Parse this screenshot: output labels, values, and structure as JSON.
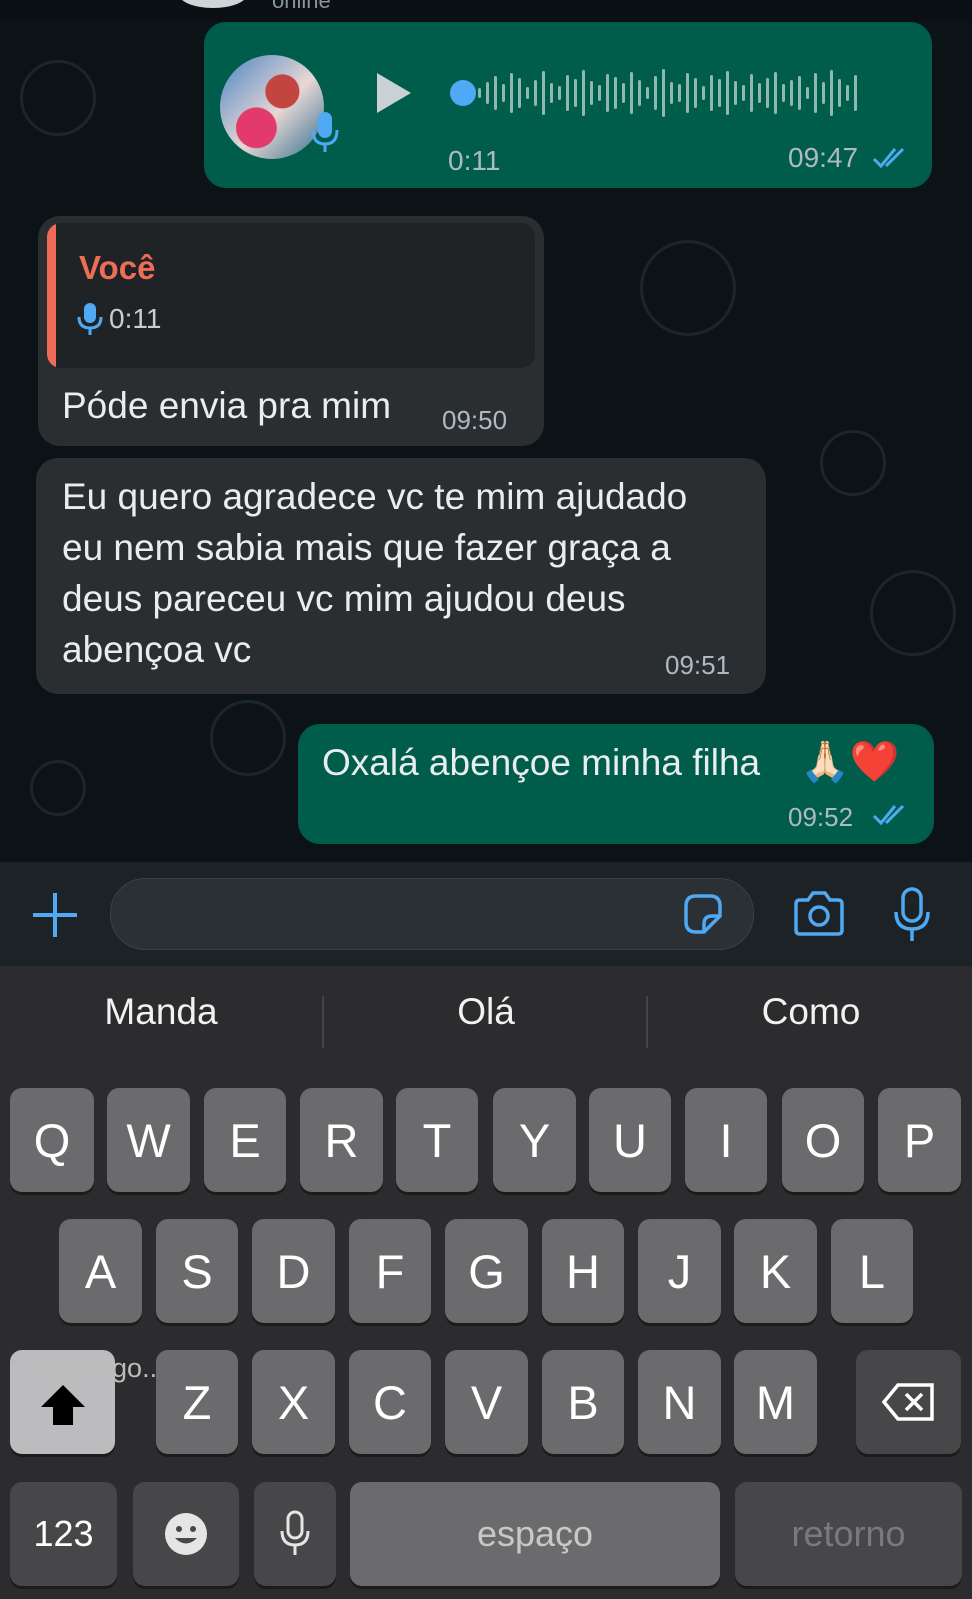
{
  "header": {
    "status": "online"
  },
  "messages": {
    "voice": {
      "duration": "0:11",
      "time": "09:47"
    },
    "reply": {
      "quote_author": "Você",
      "quote_duration": "0:11",
      "text": "Póde envia pra mim",
      "time": "09:50"
    },
    "thanks": {
      "lines": [
        "Eu quero agradece vc te mim ajudado",
        "eu nem sabia mais que fazer graça a",
        "deus pareceu vc mim ajudou deus",
        "abençoa vc"
      ],
      "time": "09:51"
    },
    "blessing": {
      "text": "Oxalá abençoe minha filha",
      "emojis": "🙏🏻❤️",
      "time": "09:52"
    }
  },
  "composer": {
    "add_icon": "plus-icon",
    "sticker_icon": "sticker-icon",
    "camera_icon": "camera-icon",
    "mic_icon": "microphone-icon"
  },
  "keyboard": {
    "suggestions": [
      "Manda",
      "Olá",
      "Como"
    ],
    "row1": [
      "Q",
      "W",
      "E",
      "R",
      "T",
      "Y",
      "U",
      "I",
      "O",
      "P"
    ],
    "row2": [
      "A",
      "S",
      "D",
      "F",
      "G",
      "H",
      "J",
      "K",
      "L"
    ],
    "row3": [
      "Z",
      "X",
      "C",
      "V",
      "B",
      "N",
      "M"
    ],
    "numbers_label": "123",
    "space_label": "espaço",
    "return_label": "retorno",
    "dictation_placeholder": "Diga algo..."
  },
  "colors": {
    "outgoing_bubble": "#005c4b",
    "incoming_bubble": "#2a2e31",
    "accent_blue": "#4fa9f4",
    "quote_author": "#ef6c57"
  }
}
